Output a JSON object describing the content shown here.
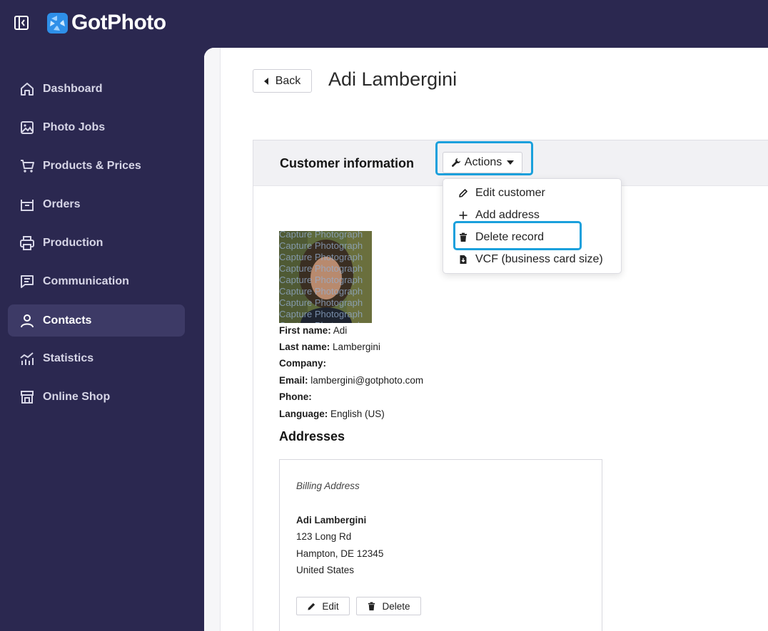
{
  "app": {
    "brand": "GotPhoto"
  },
  "sidebar": {
    "items": [
      {
        "label": "Dashboard",
        "icon": "home-icon"
      },
      {
        "label": "Photo Jobs",
        "icon": "image-icon"
      },
      {
        "label": "Products & Prices",
        "icon": "cart-icon"
      },
      {
        "label": "Orders",
        "icon": "box-icon"
      },
      {
        "label": "Production",
        "icon": "printer-icon"
      },
      {
        "label": "Communication",
        "icon": "message-icon"
      },
      {
        "label": "Contacts",
        "icon": "user-icon",
        "active": true
      },
      {
        "label": "Statistics",
        "icon": "chart-icon"
      },
      {
        "label": "Online Shop",
        "icon": "store-icon"
      }
    ]
  },
  "header": {
    "back_label": "Back",
    "title": "Adi Lambergini"
  },
  "customer": {
    "section_title": "Customer information",
    "actions_label": "Actions",
    "menu": [
      {
        "label": "Edit customer",
        "icon": "pencil-icon"
      },
      {
        "label": "Add address",
        "icon": "plus-icon"
      },
      {
        "label": "Delete record",
        "icon": "trash-icon"
      },
      {
        "label": "VCF (business card size)",
        "icon": "file-download-icon"
      }
    ],
    "photo_watermark": "Capture Photograph",
    "fields": [
      {
        "label": "First name:",
        "value": "Adi"
      },
      {
        "label": "Last name:",
        "value": "Lambergini"
      },
      {
        "label": "Company:",
        "value": ""
      },
      {
        "label": "Email:",
        "value": "lambergini@gotphoto.com"
      },
      {
        "label": "Phone:",
        "value": ""
      },
      {
        "label": "Language:",
        "value": "English (US)"
      }
    ]
  },
  "addresses": {
    "heading": "Addresses",
    "billing": {
      "type": "Billing Address",
      "name": "Adi Lambergini",
      "street": "123 Long Rd",
      "city": "Hampton, DE 12345",
      "country": "United States",
      "edit_label": "Edit",
      "delete_label": "Delete"
    }
  },
  "colors": {
    "sidebar": "#2b2850",
    "highlight": "#1aa0dc",
    "active_item": "#3d3a66"
  }
}
